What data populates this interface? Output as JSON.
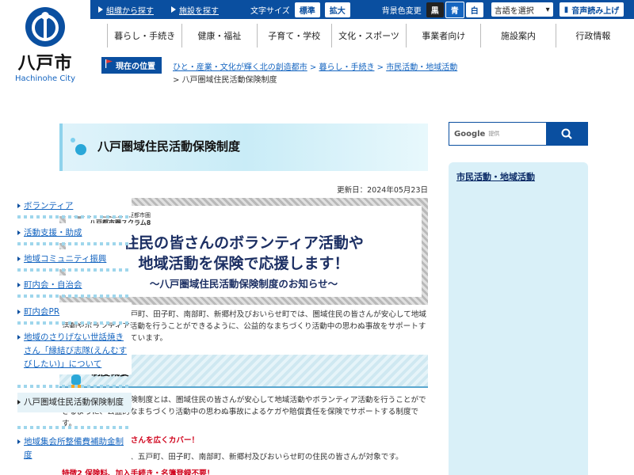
{
  "header": {
    "city_name": "八戸市",
    "city_name_en": "Hachinohe City",
    "topbar": {
      "search_by_org": "組織から探す",
      "search_by_facility": "施設を探す",
      "font_size_label": "文字サイズ",
      "font_standard": "標準",
      "font_large": "拡大",
      "bg_color_label": "背景色変更",
      "bg_black": "黒",
      "bg_blue": "青",
      "bg_white": "白",
      "language_select": "言語を選択",
      "voice_read": "音声読み上げ"
    },
    "global_nav": [
      "暮らし・手続き",
      "健康・福祉",
      "子育て・学校",
      "文化・スポーツ",
      "事業者向け",
      "施設案内",
      "行政情報"
    ]
  },
  "breadcrumb": {
    "badge": "現在の位置",
    "items": [
      "ひと・産業・文化が輝く北の創造都市",
      "暮らし・手続き",
      "市民活動・地域活動"
    ],
    "current": "八戸圏域住民活動保険制度"
  },
  "main": {
    "page_title": "八戸圏域住民活動保険制度",
    "updated": "更新日：2024年05月23日",
    "banner": {
      "org_line1": "八戸圏域連携中枢都市圏",
      "org_line2": "八戸都市圏スクラム8",
      "logo_glyph": "8",
      "headline1": "住民の皆さんのボランティア活動や",
      "headline2": "地域活動を保険で応援します！",
      "subheadline": "～八戸圏域住民活動保険制度のお知らせ～"
    },
    "intro": "八戸市、三戸町、五戸町、田子町、南部町、新郷村及びおいらせ町では、圏域住民の皆さんが安心して地域活動やボランティア活動を行うことができるように、公益的なまちづくり活動中の思わぬ事故をサポートするため保険に加入しています。",
    "section_title": "制度概要",
    "overview": "八戸圏域住民活動保険制度とは、圏域住民の皆さんが安心して地域活動やボランティア活動を行うことができるように、公益的なまちづくり活動中の思わぬ事故によるケガや賠償責任を保険でサポートする制度です。",
    "feature1_title": "特徴1 圏域住民の皆さんを広くカバー！",
    "feature1_text": "主に八戸市、三戸町、五戸町、田子町、南部町、新郷村及びおいらせ町の住民の皆さんが対象です。",
    "feature2_title": "特徴2 保険料、加入手続き・名簿登録不要！"
  },
  "search": {
    "google_label": "Google",
    "provided_label": "提供"
  },
  "sidebar": {
    "title": "市民活動・地域活動",
    "items": [
      "ボランティア",
      "活動支援・助成",
      "地域コミュニティ振興",
      "町内会・自治会",
      "町内会PR",
      "地域のさりげない世話焼きさん「縁結び志隊(えんむすびしたい)」について",
      "八戸圏域住民活動保険制度",
      "地域集会所整備費補助金制度"
    ],
    "current_index": 6
  },
  "colors": {
    "brand_blue": "#0a4fa0",
    "feature_red": "#d0021b",
    "sidebar_bg": "#d9f0f8"
  }
}
